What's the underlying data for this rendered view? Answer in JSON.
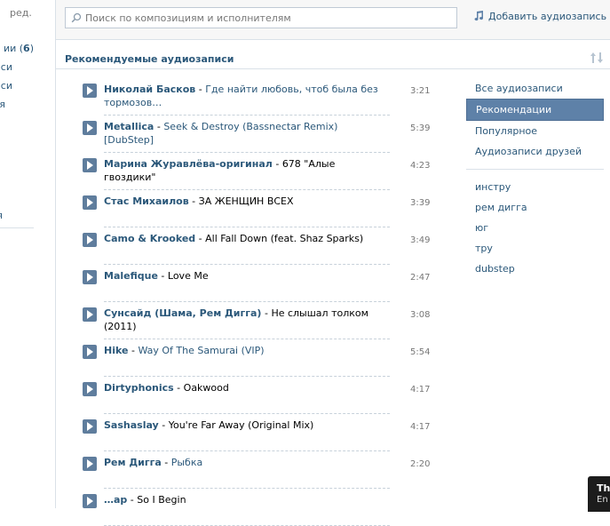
{
  "left_nav": {
    "edit_label": "ред.",
    "items": [
      {
        "text": "ии",
        "count": "6"
      },
      {
        "text": "иси"
      },
      {
        "text": "иси"
      },
      {
        "text": "я"
      },
      {
        "text": "я"
      }
    ]
  },
  "search": {
    "placeholder": "Поиск по композициям и исполнителям",
    "value": ""
  },
  "add_audio_label": "Добавить аудиозапись",
  "section_title": "Рекомендуемые аудиозаписи",
  "tracks": [
    {
      "artist": "Николай Басков",
      "title": "Где найти любовь, чтоб была без тормозов…",
      "duration": "3:21",
      "title_link": true
    },
    {
      "artist": "Metallica",
      "title": "Seek & Destroy (Bassnectar Remix) [DubStep]",
      "duration": "5:39",
      "title_link": true
    },
    {
      "artist": "Марина Журавлёва-оригинал",
      "title": "678 \"Алые гвоздики\"",
      "duration": "4:23",
      "title_link": false
    },
    {
      "artist": "Стас Михаилов",
      "title": "ЗА ЖЕНЩИН ВСЕХ",
      "duration": "3:39",
      "title_link": false
    },
    {
      "artist": "Camo & Krooked",
      "title": "All Fall Down (feat. Shaz Sparks)",
      "duration": "3:49",
      "title_link": false
    },
    {
      "artist": "Malefique",
      "title": "Love Me",
      "duration": "2:47",
      "title_link": false
    },
    {
      "artist": "Сунсайд (Шама, Рем Дигга)",
      "title": "Не слышал толком (2011)",
      "duration": "3:08",
      "title_link": false
    },
    {
      "artist": "Hike",
      "title": "Way Of The Samurai (VIP)",
      "duration": "5:54",
      "title_link": true
    },
    {
      "artist": "Dirtyphonics",
      "title": "Oakwood",
      "duration": "4:17",
      "title_link": false
    },
    {
      "artist": "Sashaslay",
      "title": "You're Far Away (Original Mix)",
      "duration": "4:17",
      "title_link": false
    },
    {
      "artist": "Рем Дигга",
      "title": "Рыбка",
      "duration": "2:20",
      "title_link": true
    },
    {
      "artist": "…ap",
      "title": "So I Begin",
      "duration": "",
      "title_link": false
    }
  ],
  "menu": {
    "items": [
      {
        "label": "Все аудиозаписи",
        "active": false
      },
      {
        "label": "Рекомендации",
        "active": true
      },
      {
        "label": "Популярное",
        "active": false
      },
      {
        "label": "Аудиозаписи друзей",
        "active": false
      }
    ],
    "tags": [
      "инстру",
      "рем дигга",
      "юг",
      "тру",
      "dubstep"
    ]
  },
  "corner_popup": {
    "line1": "Th",
    "line2": "En"
  },
  "colors": {
    "link": "#2b587a",
    "active_bg": "#5e81a8",
    "play_btn": "#5f7d9d"
  }
}
